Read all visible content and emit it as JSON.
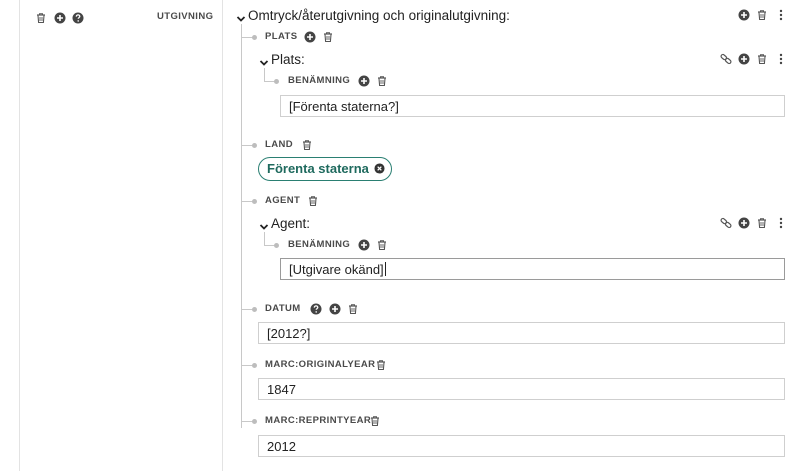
{
  "left": {
    "section_label": "UTGIVNING"
  },
  "main": {
    "heading": "Omtryck/återutgivning och originalutgivning:",
    "plats": {
      "label": "PLATS",
      "sub_heading": "Plats:",
      "name_label": "BENÄMNING",
      "name_value": "[Förenta staterna?]"
    },
    "land": {
      "label": "LAND",
      "value": "Förenta staterna"
    },
    "agent": {
      "label": "AGENT",
      "sub_heading": "Agent:",
      "name_label": "BENÄMNING",
      "name_value": "[Utgivare okänd]"
    },
    "datum": {
      "label": "DATUM",
      "value": "[2012?]"
    },
    "original_year": {
      "label": "MARC:ORIGINALYEAR",
      "value": "1847"
    },
    "reprint_year": {
      "label": "MARC:REPRINTYEAR",
      "value": "2012"
    }
  },
  "colors": {
    "accent": "#2a7f72",
    "icon": "#444444",
    "border": "#cfcfcf"
  },
  "icons": [
    "trash-icon",
    "plus-circle-icon",
    "help-circle-icon",
    "link-icon",
    "more-vertical-icon",
    "chevron-down-icon",
    "remove-circle-icon"
  ]
}
